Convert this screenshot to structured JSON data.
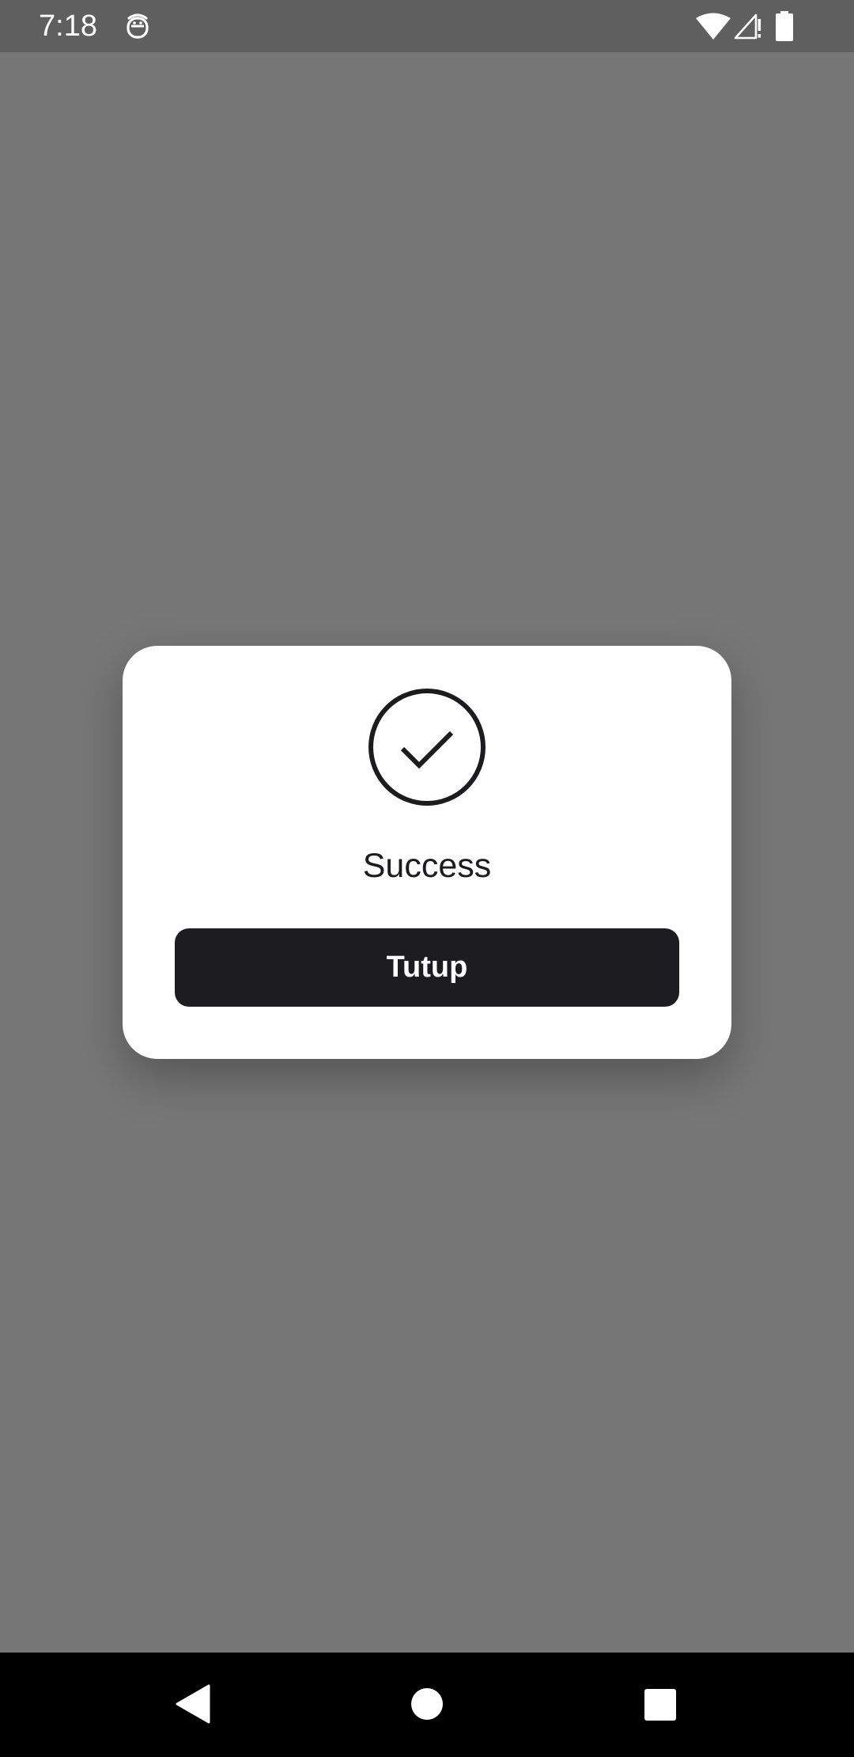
{
  "status_bar": {
    "time": "7:18",
    "icons": [
      "app-notification-icon",
      "wifi-icon",
      "signal-icon",
      "battery-icon"
    ]
  },
  "dialog": {
    "icon": "check-circle-icon",
    "message": "Success",
    "close_button_label": "Tutup"
  },
  "navigation_bar": {
    "buttons": [
      "back-icon",
      "home-icon",
      "recents-icon"
    ]
  },
  "colors": {
    "scrim": "#777777",
    "status_bar": "#5f5f5f",
    "dialog_background": "#ffffff",
    "button_background": "#1c1c21",
    "button_text": "#ffffff",
    "icon_stroke": "#1c1c1f",
    "navigation_bar": "#000000"
  }
}
